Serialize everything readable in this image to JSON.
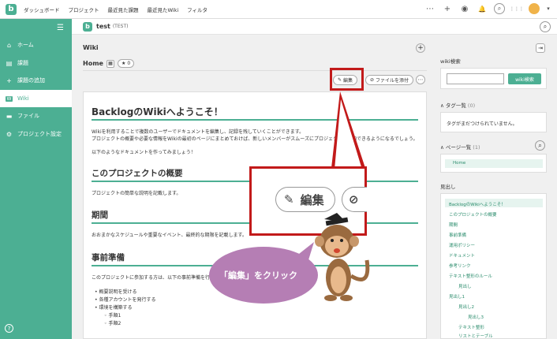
{
  "topnav": {
    "items": [
      "ダッシュボード",
      "プロジェクト",
      "最近見た課題",
      "最近見たWiki",
      "フィルタ"
    ]
  },
  "topicons": {
    "more": "⋯",
    "add": "+",
    "watch": "◉",
    "bell": "🔔",
    "search": "⌕",
    "apps": "⋮⋮⋮",
    "chevron": "▾"
  },
  "logo": "b",
  "sidebar": {
    "menu_glyph": "☰",
    "items": [
      {
        "icon": "⌂",
        "label": "ホーム"
      },
      {
        "icon": "▤",
        "label": "課題"
      },
      {
        "icon": "+",
        "label": "課題の追加"
      },
      {
        "icon": "W",
        "label": "Wiki"
      },
      {
        "icon": "▬",
        "label": "ファイル"
      },
      {
        "icon": "⚙",
        "label": "プロジェクト設定"
      }
    ],
    "help": "?"
  },
  "project": {
    "logo": "b",
    "name": "test",
    "key": "(TEST)"
  },
  "wiki": {
    "title": "Wiki",
    "page": "Home",
    "star_count": "0",
    "edit_label": "編集",
    "attach_label": "ファイルを添付"
  },
  "content": {
    "h1": "BacklogのWikiへようこそ！",
    "intro1": "Wikiを利用することで複数のユーザーでドキュメントを編集し、記録を残していくことができます。",
    "intro2": "プロジェクトの概要や必要な情報をWikiの最初のページにまとめておけば、新しいメンバーがスムーズにプロジェクトに参加できるようになるでしょう。",
    "intro3": "以下のようなドキュメントを作ってみましょう！",
    "h2_overview": "このプロジェクトの概要",
    "overview_text": "プロジェクトの簡単な説明を記載します。",
    "h2_period": "期間",
    "period_text": "おおまかなスケジュールや重要なイベント、最終的な期限を記載します。",
    "h2_prep": "事前準備",
    "prep_text": "このプロジェクトに参加する方は、以下の事前準備を行",
    "list": [
      "概要説明を受ける",
      "各種アカウントを発行する",
      "環境を構築する"
    ],
    "sublist": [
      "手順1",
      "手順2"
    ]
  },
  "callout": {
    "zoom_label": "編集",
    "speech": "「編集」をクリック"
  },
  "right": {
    "wiki_search_label": "wiki検索",
    "wiki_search_button": "wiki検索",
    "tags_label": "タグ一覧",
    "tags_count": "(0)",
    "tags_empty": "タグがまだつけられていません。",
    "pages_label": "ページ一覧",
    "pages_count": "(1)",
    "page_item": "Home",
    "toc_label": "見出し",
    "toc": [
      {
        "text": "BacklogのWikiへようこそ！",
        "level": 0
      },
      {
        "text": "このプロジェクトの概要",
        "level": 1
      },
      {
        "text": "期間",
        "level": 1
      },
      {
        "text": "事前準備",
        "level": 1
      },
      {
        "text": "運用ポリシー",
        "level": 1
      },
      {
        "text": "ドキュメント",
        "level": 1
      },
      {
        "text": "参考リンク",
        "level": 1
      },
      {
        "text": "テキスト整形のルール",
        "level": 1
      },
      {
        "text": "見出し",
        "level": 2
      },
      {
        "text": "見出し1",
        "level": 1
      },
      {
        "text": "見出し2",
        "level": 2
      },
      {
        "text": "見出し3",
        "level": 3
      },
      {
        "text": "テキスト整形",
        "level": 2
      },
      {
        "text": "リストとテーブル",
        "level": 2
      }
    ]
  }
}
